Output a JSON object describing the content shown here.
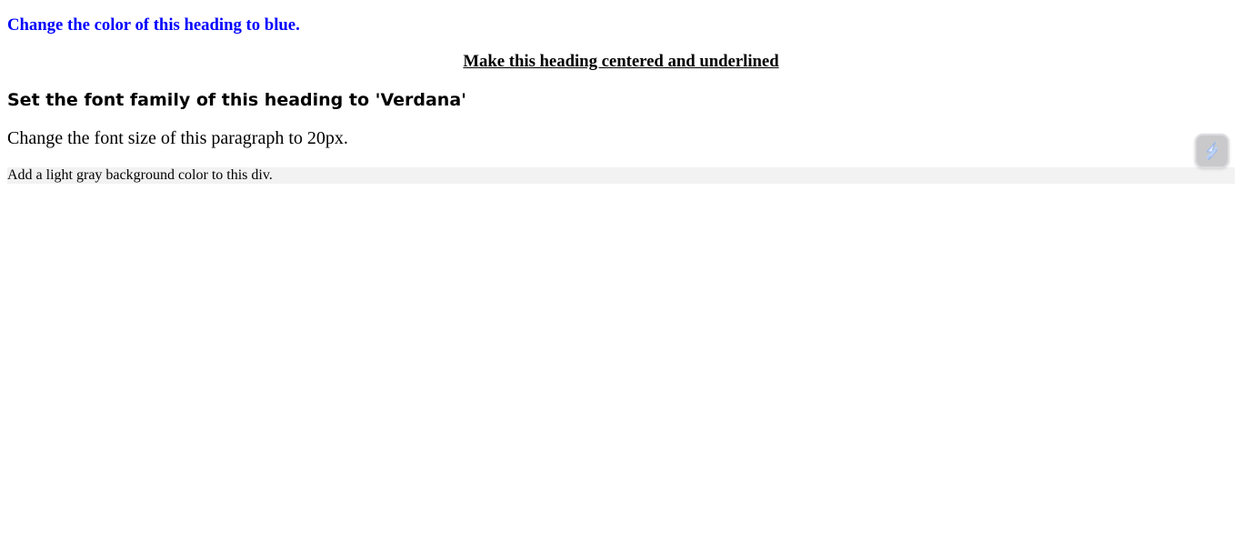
{
  "headings": {
    "blue": "Change the color of this heading to blue.",
    "centered": "Make this heading centered and underlined",
    "verdana": "Set the font family of this heading to 'Verdana'"
  },
  "paragraph": {
    "text": "Change the font size of this paragraph to 20px."
  },
  "gray_div": {
    "text": "Add a light gray background color to this div."
  },
  "colors": {
    "blue_heading": "#0000ff",
    "gray_background": "#f2f2f2",
    "text": "#000000"
  },
  "extension": {
    "icon": "lightning-bolt-icon"
  }
}
